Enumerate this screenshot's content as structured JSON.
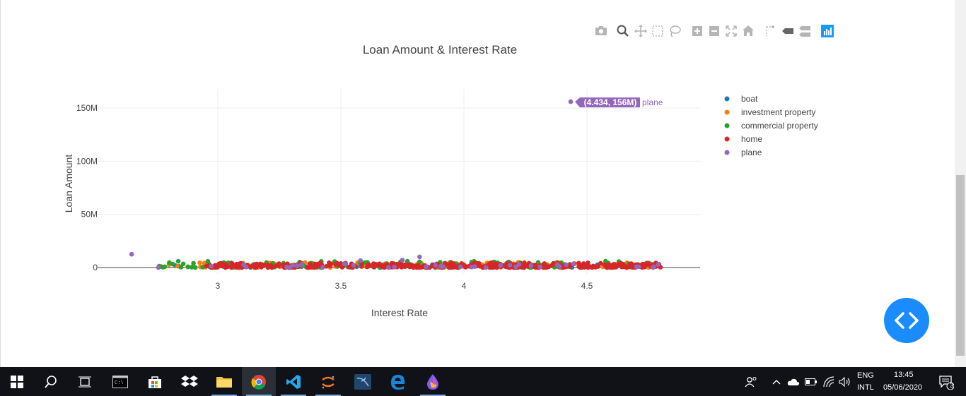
{
  "chart_data": {
    "type": "scatter",
    "title": "Loan Amount & Interest Rate",
    "xlabel": "Interest Rate",
    "ylabel": "Loan Amount",
    "xlim": [
      2.55,
      5.0
    ],
    "ylim": [
      -5000000,
      168000000
    ],
    "x_ticks": [
      3,
      3.5,
      4,
      4.5
    ],
    "x_tick_labels": [
      "3",
      "3.5",
      "4",
      "4.5"
    ],
    "y_ticks": [
      0,
      50000000,
      100000000,
      150000000
    ],
    "y_tick_labels": [
      "0",
      "50M",
      "100M",
      "150M"
    ],
    "grid": true,
    "legend_position": "right",
    "series": [
      {
        "name": "boat",
        "color": "#1f77b4",
        "x_range": [
          2.8,
          4.8
        ],
        "y_range": [
          0,
          3500000
        ],
        "count": 45
      },
      {
        "name": "investment property",
        "color": "#ff7f0e",
        "x_range": [
          2.75,
          4.8
        ],
        "y_range": [
          0,
          5000000
        ],
        "count": 90
      },
      {
        "name": "commercial property",
        "color": "#2ca02c",
        "x_range": [
          2.75,
          4.8
        ],
        "y_range": [
          0,
          6000000
        ],
        "count": 160
      },
      {
        "name": "home",
        "color": "#d62728",
        "x_range": [
          2.95,
          4.8
        ],
        "y_range": [
          0,
          4500000
        ],
        "count": 420
      },
      {
        "name": "plane",
        "color": "#9467bd",
        "x_range": [
          2.75,
          4.8
        ],
        "y_range": [
          0,
          4000000
        ],
        "count": 40,
        "outliers": [
          {
            "x": 2.65,
            "y": 12500000
          },
          {
            "x": 3.82,
            "y": 10000000
          },
          {
            "x": 3.75,
            "y": 7000000
          },
          {
            "x": 3.58,
            "y": 6500000
          },
          {
            "x": 4.434,
            "y": 156000000
          }
        ]
      }
    ],
    "hover": {
      "text": "(4.434, 156M)",
      "series": "plane",
      "x": 4.434,
      "y": 156000000
    }
  },
  "modebar": [
    "camera-icon",
    "zoom-icon",
    "pan-icon",
    "box-select-icon",
    "lasso-icon",
    "zoom-in-icon",
    "zoom-out-icon",
    "autoscale-icon",
    "reset-axes-icon",
    "spike-lines-icon",
    "hover-closest-icon",
    "hover-compare-icon",
    "plotly-logo-icon"
  ],
  "taskbar": {
    "language_top": "ENG",
    "language_bottom": "INTL",
    "time": "13:45",
    "date": "05/06/2020",
    "notification_count": "3"
  }
}
